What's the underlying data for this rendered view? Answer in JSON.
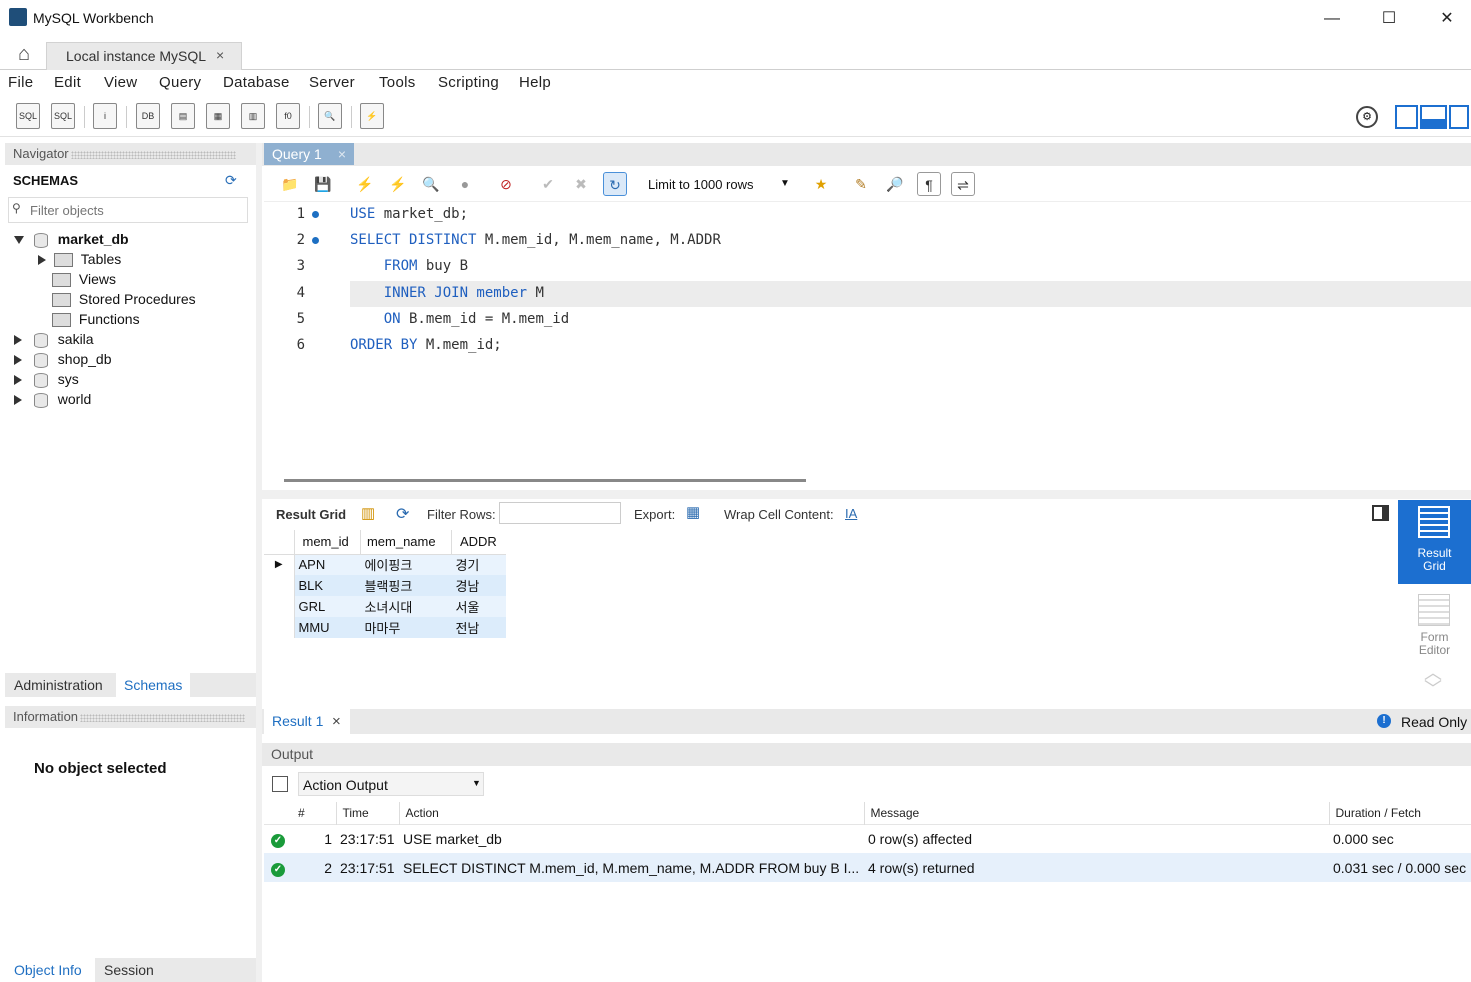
{
  "window": {
    "title": "MySQL Workbench",
    "minimize": "—",
    "maximize": "☐",
    "close": "✕"
  },
  "tabs": {
    "home_icon": "home-icon",
    "connection_tab": "Local instance MySQL",
    "close": "×"
  },
  "menu": [
    "File",
    "Edit",
    "View",
    "Query",
    "Database",
    "Server",
    "Tools",
    "Scripting",
    "Help"
  ],
  "navigator": {
    "title": "Navigator",
    "schemas_label": "SCHEMAS",
    "filter_placeholder": "Filter objects",
    "tree": [
      {
        "name": "market_db",
        "expanded": true,
        "children": [
          "Tables",
          "Views",
          "Stored Procedures",
          "Functions"
        ]
      },
      {
        "name": "sakila"
      },
      {
        "name": "shop_db"
      },
      {
        "name": "sys"
      },
      {
        "name": "world"
      }
    ],
    "bottom_tabs": [
      "Administration",
      "Schemas"
    ],
    "active_bottom_tab": "Schemas"
  },
  "information": {
    "title": "Information",
    "message": "No object selected",
    "tabs": [
      "Object Info",
      "Session"
    ]
  },
  "query_tab": {
    "label": "Query 1",
    "close": "×"
  },
  "query_toolbar": {
    "limit_label": "Limit to 1000 rows"
  },
  "editor": {
    "lines": [
      {
        "num": "1",
        "bp": true,
        "parts": [
          [
            "USE",
            "k"
          ],
          [
            " market_db;",
            "t"
          ]
        ]
      },
      {
        "num": "2",
        "bp": true,
        "parts": [
          [
            "SELECT DISTINCT",
            "k"
          ],
          [
            " M.mem_id, M.mem_name, M.ADDR",
            "t"
          ]
        ]
      },
      {
        "num": "3",
        "bp": false,
        "parts": [
          [
            "    FROM",
            "k"
          ],
          [
            " buy B",
            "t"
          ]
        ]
      },
      {
        "num": "4",
        "bp": false,
        "parts": [
          [
            "    INNER JOIN member",
            "k"
          ],
          [
            " M",
            "t"
          ]
        ]
      },
      {
        "num": "5",
        "bp": false,
        "parts": [
          [
            "    ON",
            "k"
          ],
          [
            " B.mem_id = M.mem_id",
            "t"
          ]
        ]
      },
      {
        "num": "6",
        "bp": false,
        "parts": [
          [
            "ORDER BY",
            "k"
          ],
          [
            " M.mem_id;",
            "t"
          ]
        ]
      }
    ]
  },
  "result_toolbar": {
    "result_grid": "Result Grid",
    "filter_rows": "Filter Rows:",
    "export": "Export:",
    "wrap": "Wrap Cell Content:"
  },
  "result_grid": {
    "columns": [
      "mem_id",
      "mem_name",
      "ADDR"
    ],
    "rows": [
      [
        "APN",
        "에이핑크",
        "경기"
      ],
      [
        "BLK",
        "블랙핑크",
        "경남"
      ],
      [
        "GRL",
        "소녀시대",
        "서울"
      ],
      [
        "MMU",
        "마마무",
        "전남"
      ]
    ]
  },
  "right_rail": {
    "result_grid": "Result Grid",
    "form_editor": "Form Editor"
  },
  "result_tab": {
    "label": "Result 1",
    "close": "×",
    "read_only": "Read Only"
  },
  "output": {
    "title": "Output",
    "selector": "Action Output",
    "columns": [
      "#",
      "Time",
      "Action",
      "Message",
      "Duration / Fetch"
    ],
    "rows": [
      {
        "n": "1",
        "time": "23:17:51",
        "action": "USE market_db",
        "message": "0 row(s) affected",
        "duration": "0.000 sec"
      },
      {
        "n": "2",
        "time": "23:17:51",
        "action": "SELECT DISTINCT M.mem_id, M.mem_name, M.ADDR FROM buy B    I...",
        "message": "4 row(s) returned",
        "duration": "0.031 sec / 0.000 sec"
      }
    ]
  }
}
